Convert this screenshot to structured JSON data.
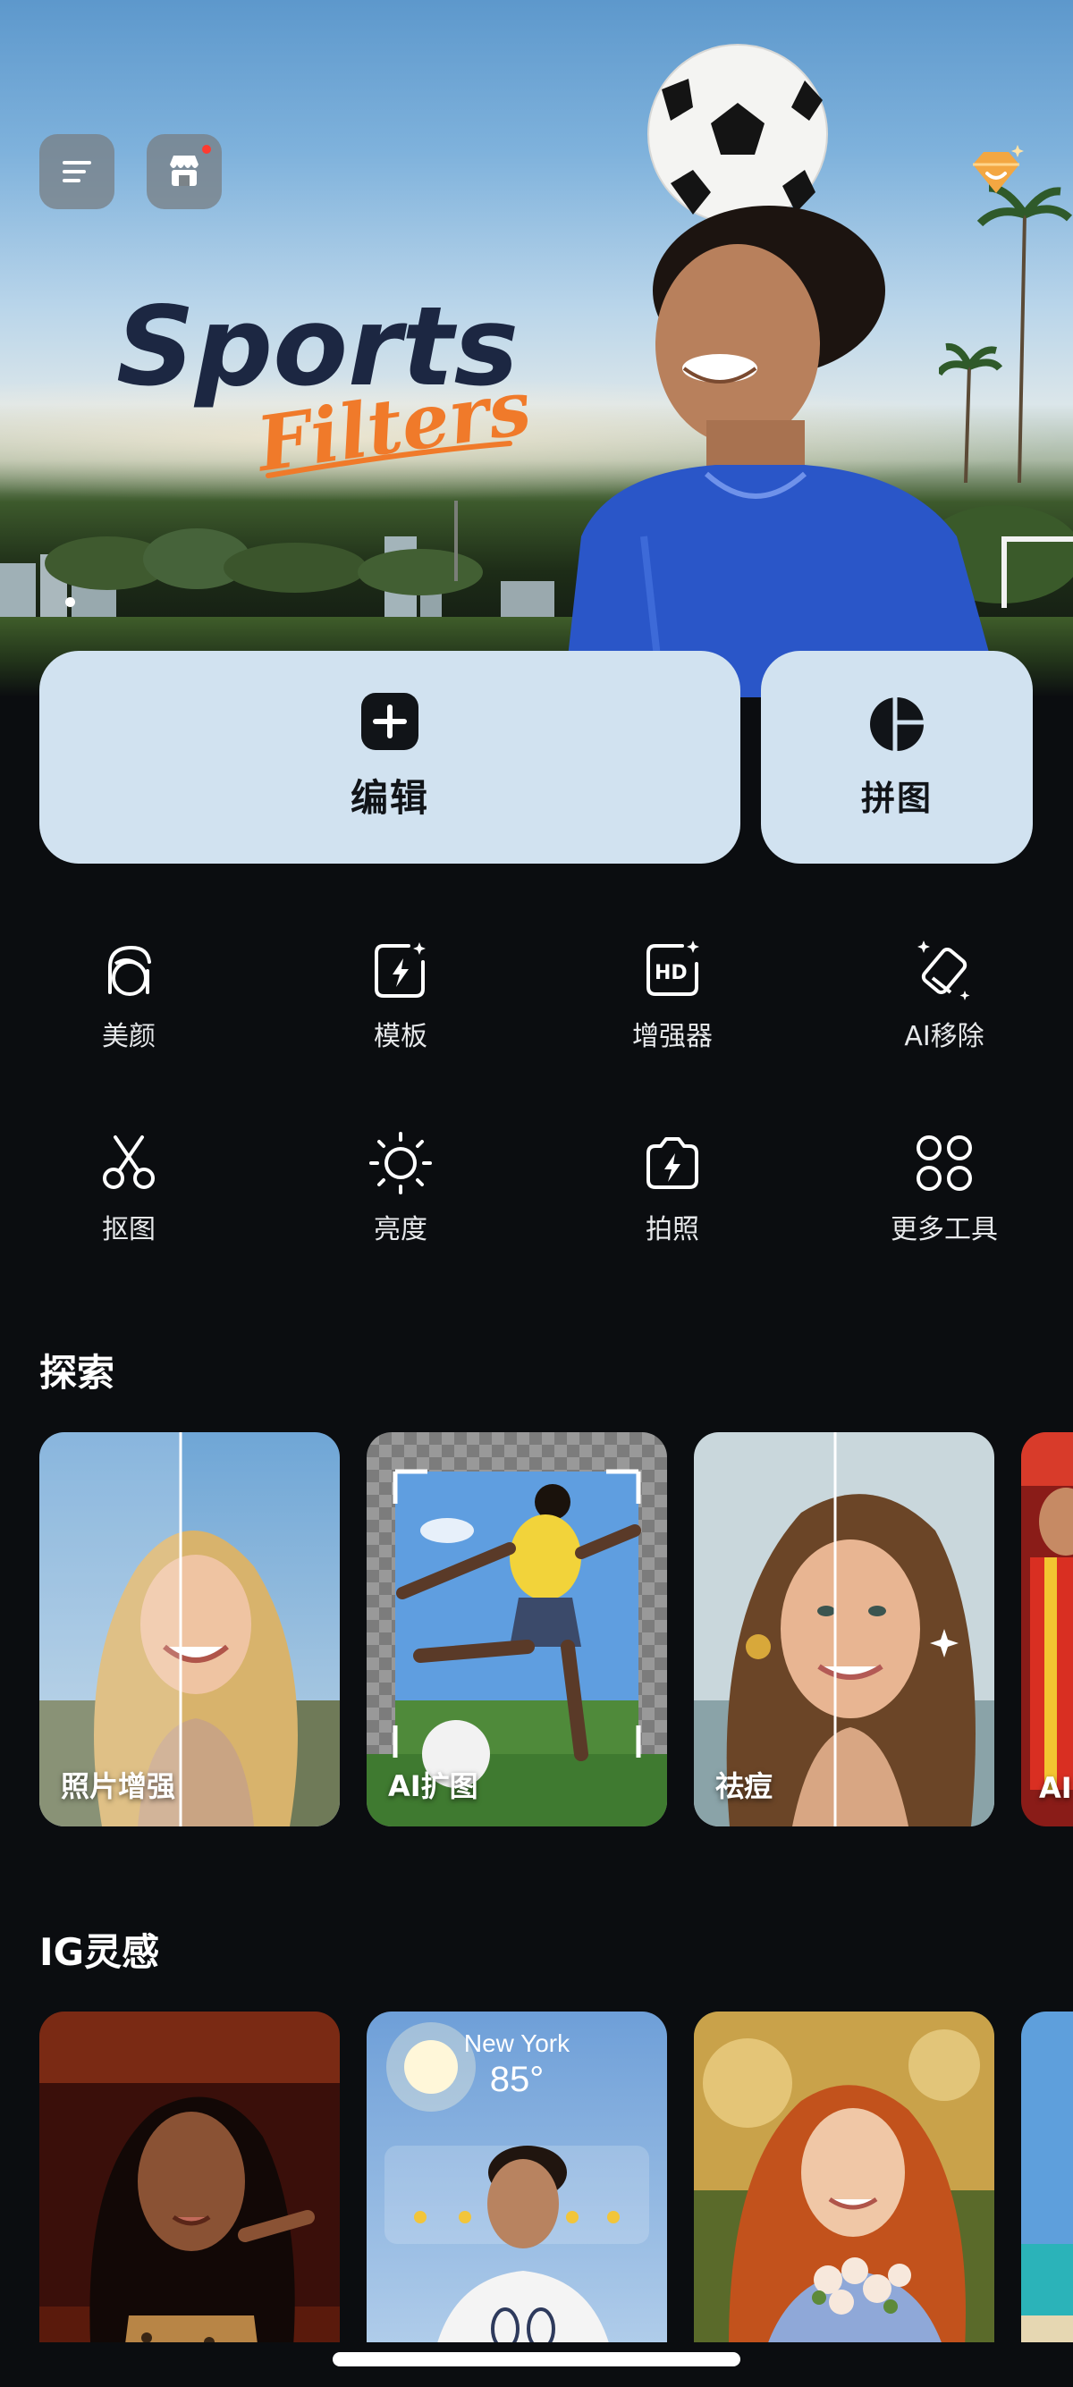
{
  "hero": {
    "logo_line1": "Sports",
    "logo_line2": "Filters",
    "active_slide": 1
  },
  "icons": {
    "menu": "menu-lines-icon",
    "store": "store-icon",
    "vip": "vip-diamond-icon"
  },
  "cards": {
    "edit_label": "编辑",
    "collage_label": "拼图"
  },
  "tools": [
    {
      "label": "美颜",
      "icon": "face-beauty-icon"
    },
    {
      "label": "模板",
      "icon": "template-icon"
    },
    {
      "label": "增强器",
      "icon": "hd-enhance-icon"
    },
    {
      "label": "AI移除",
      "icon": "eraser-icon"
    },
    {
      "label": "抠图",
      "icon": "scissors-icon"
    },
    {
      "label": "亮度",
      "icon": "brightness-icon"
    },
    {
      "label": "拍照",
      "icon": "camera-icon"
    },
    {
      "label": "更多工具",
      "icon": "more-tools-icon"
    }
  ],
  "explore": {
    "title": "探索",
    "items": [
      {
        "label": "照片增强"
      },
      {
        "label": "AI扩图"
      },
      {
        "label": "祛痘"
      },
      {
        "label": "AI"
      }
    ]
  },
  "ig": {
    "title": "IG灵感",
    "weather_city": "New York",
    "weather_temp": "85°"
  },
  "colors": {
    "background": "#0b0d10",
    "card": "#d1e2f0",
    "accent_orange": "#f07a2a",
    "logo_navy": "#1c2742"
  }
}
